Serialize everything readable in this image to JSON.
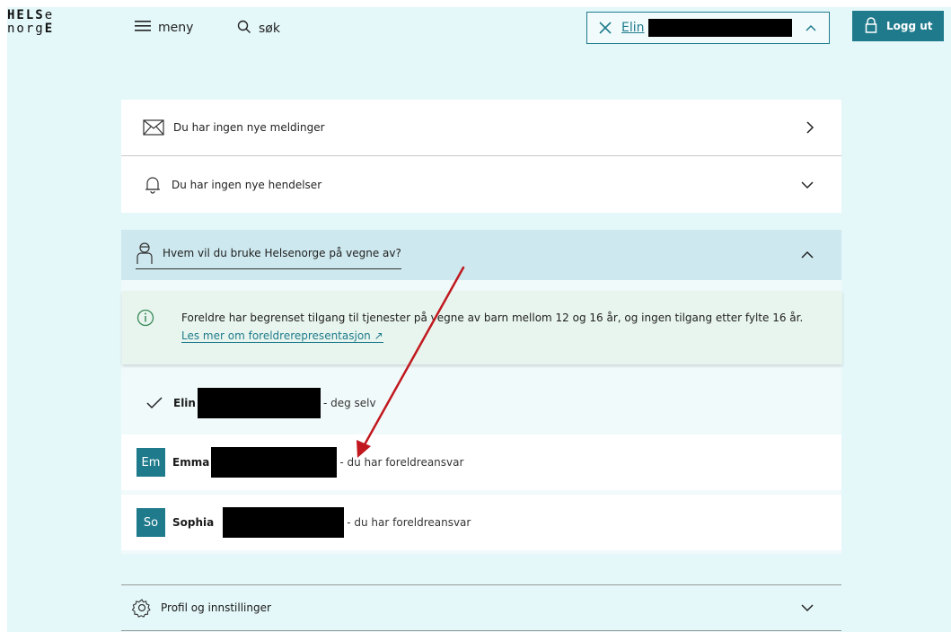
{
  "header": {
    "logo_line1": "HELSe",
    "logo_line2": "norgE",
    "menu_label": "meny",
    "search_label": "søk",
    "user_name": "Elin",
    "logout_label": "Logg ut"
  },
  "messages": {
    "label": "Du har ingen nye meldinger"
  },
  "events": {
    "label": "Du har ingen nye hendelser"
  },
  "representation": {
    "heading": "Hvem vil du bruke Helsenorge på vegne av?",
    "info_text": "Foreldre har begrenset tilgang til tjenester på vegne av barn mellom 12 og 16 år, og ingen tilgang etter fylte 16 år.",
    "info_link": "Les mer om foreldrerepresentasjon",
    "people": [
      {
        "initials": "",
        "name": "Elin",
        "desc": "- deg selv",
        "selected": true
      },
      {
        "initials": "Em",
        "name": "Emma",
        "desc": "- du har foreldreansvar",
        "selected": false
      },
      {
        "initials": "So",
        "name": "Sophia",
        "desc": "- du har foreldreansvar",
        "selected": false
      }
    ]
  },
  "profile": {
    "label": "Profil og innstillinger"
  },
  "colors": {
    "brand": "#1f7b8c",
    "background": "#e4f7f9",
    "annotation_arrow": "#c0181e"
  }
}
